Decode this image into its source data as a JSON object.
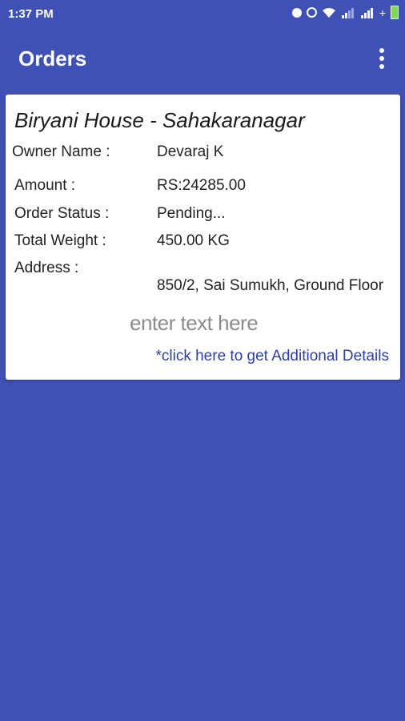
{
  "status_bar": {
    "time": "1:37 PM",
    "icons": [
      "circle-icon",
      "alarm-icon",
      "wifi-icon",
      "signal-icon",
      "signal-icon",
      "plus-icon",
      "battery-icon"
    ]
  },
  "toolbar": {
    "title": "Orders",
    "menu_icon": "more-vert-icon"
  },
  "order": {
    "restaurant": "Biryani House - Sahakaranagar",
    "owner_label": "Owner Name :",
    "owner_value": "Devaraj K",
    "amount_label": "Amount :",
    "amount_value": "RS:24285.00",
    "status_label": "Order Status :",
    "status_value": "Pending...",
    "weight_label": "Total Weight :",
    "weight_value": "450.00 KG",
    "address_label": "Address :",
    "address_value": "850/2, Sai Sumukh, Ground Floor",
    "overlay_text": "enter text here",
    "details_link": "*click here to get Additional Details"
  },
  "colors": {
    "primary": "#3f51b5",
    "link": "#2c3ea8",
    "card": "#ffffff"
  }
}
